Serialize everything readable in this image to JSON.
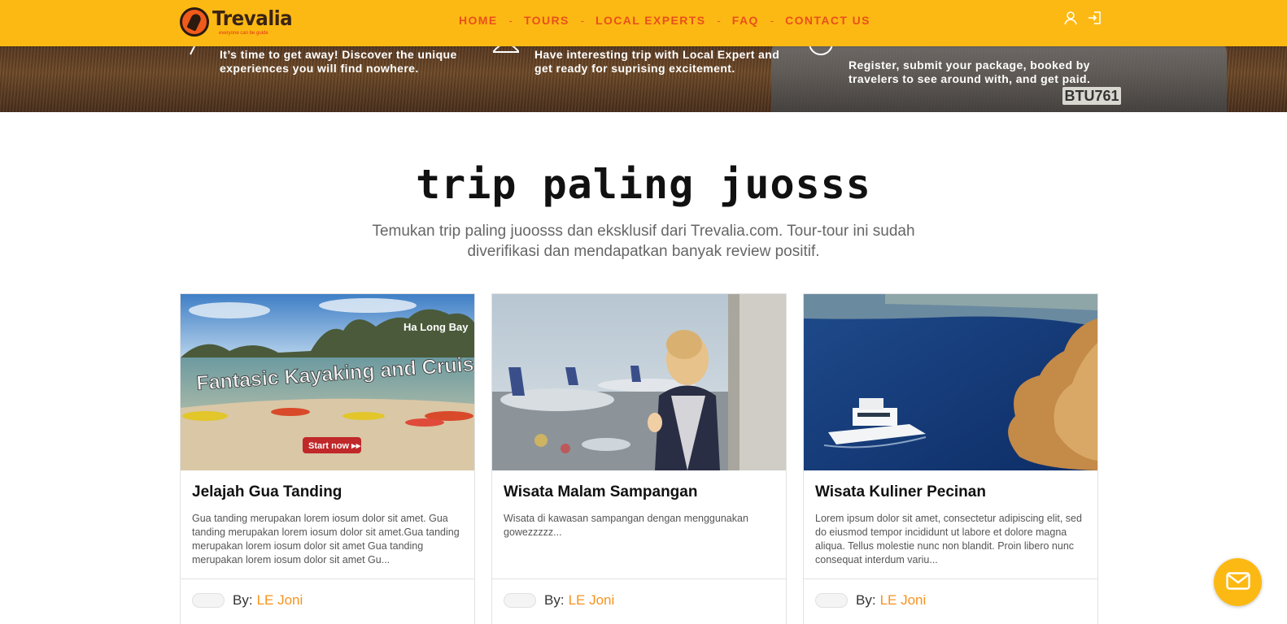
{
  "brand": {
    "name": "Trevalia",
    "tagline": "everyone can be guide"
  },
  "nav": {
    "items": [
      "HOME",
      "TOURS",
      "LOCAL EXPERTS",
      "FAQ",
      "CONTACT US"
    ],
    "separator": "-"
  },
  "header_icons": [
    "user-icon",
    "login-icon"
  ],
  "banner": {
    "columns": [
      {
        "icon": "plane-icon",
        "text": "It’s time to get away! Discover the unique experiences you will find nowhere."
      },
      {
        "icon": "person-icon",
        "text": "Have interesting trip with Local Expert and get ready for suprising excitement."
      },
      {
        "icon": "question-icon",
        "text": "Register, submit your package, booked by travelers to see around with, and get paid."
      }
    ],
    "plate_text": "BTU761"
  },
  "section": {
    "title": "trip paling juosss",
    "subtitle": "Temukan trip paling juoosss dan eksklusif dari Trevalia.com. Tour-tour ini sudah diverifikasi dan mendapatkan banyak review positif."
  },
  "cards": [
    {
      "title": "Jelajah Gua Tanding",
      "description": "Gua tanding merupakan lorem iosum dolor sit amet. Gua tanding merupakan lorem iosum dolor sit amet.Gua tanding merupakan lorem iosum dolor sit amet Gua tanding merupakan lorem iosum dolor sit amet Gu...",
      "by_label": "By:",
      "author": "LE Joni",
      "image_text": {
        "place": "Ha Long Bay",
        "headline": "Fantasic Kayaking and Cruise",
        "cta": "Start now ▸▸"
      }
    },
    {
      "title": "Wisata Malam Sampangan",
      "description": "Wisata di kawasan sampangan dengan menggunakan gowezzzzz...",
      "by_label": "By:",
      "author": "LE Joni"
    },
    {
      "title": "Wisata Kuliner Pecinan",
      "description": "Lorem ipsum dolor sit amet, consectetur adipiscing elit, sed do eiusmod tempor incididunt ut labore et dolore magna aliqua. Tellus molestie nunc non blandit. Proin libero nunc consequat interdum variu...",
      "by_label": "By:",
      "author": "LE Joni"
    }
  ],
  "chat": {
    "icon": "mail-icon"
  },
  "colors": {
    "header": "#fdb913",
    "nav_text": "#e8501c",
    "author": "#f7931e"
  }
}
